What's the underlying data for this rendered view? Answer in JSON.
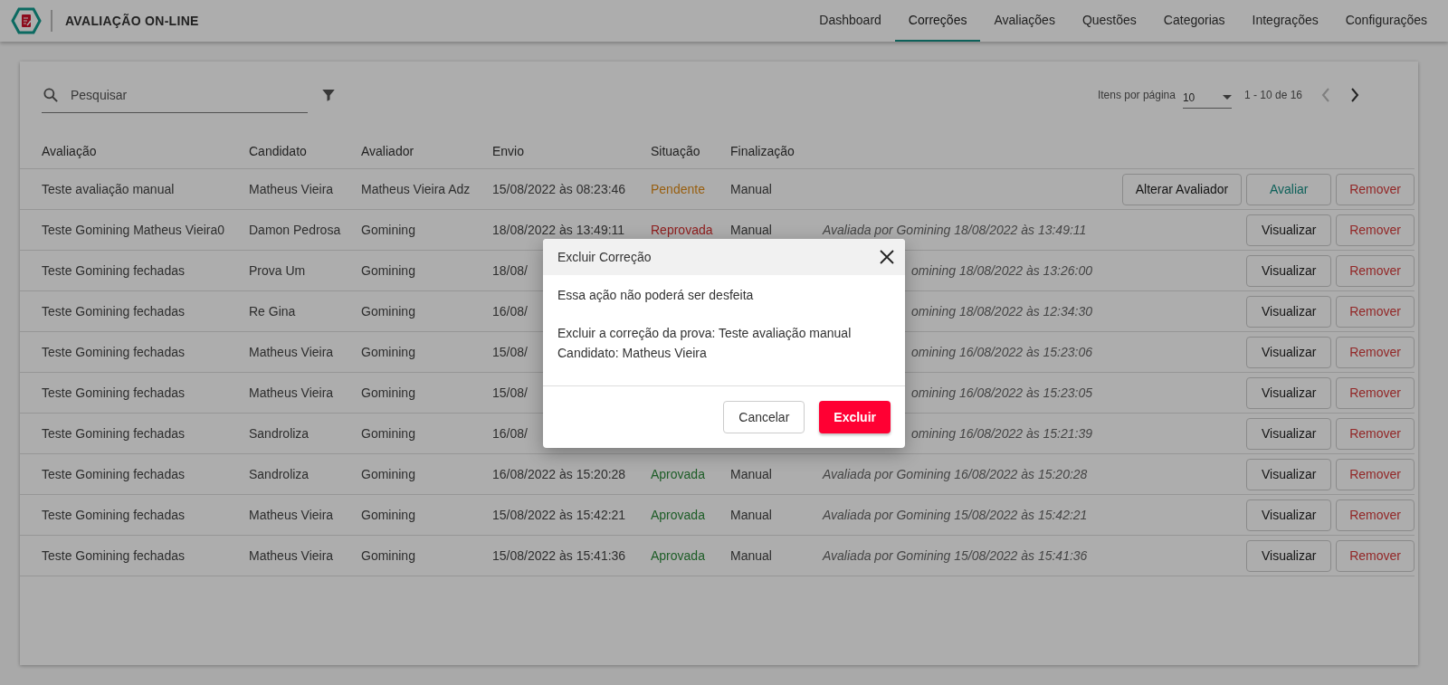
{
  "app": {
    "title": "AVALIAÇÃO ON-LINE"
  },
  "nav": [
    {
      "label": "Dashboard",
      "selected": false
    },
    {
      "label": "Correções",
      "selected": true
    },
    {
      "label": "Avaliações",
      "selected": false
    },
    {
      "label": "Questões",
      "selected": false
    },
    {
      "label": "Categorias",
      "selected": false
    },
    {
      "label": "Integrações",
      "selected": false
    },
    {
      "label": "Configurações",
      "selected": false
    }
  ],
  "search": {
    "placeholder": "Pesquisar"
  },
  "pagination": {
    "label": "Itens por página",
    "page_size": "10",
    "range": "1 - 10 de 16",
    "buttons": [
      {
        "kind": "prev",
        "disabled": true
      },
      {
        "kind": "next",
        "disabled": false
      }
    ]
  },
  "table": {
    "columns": [
      "Avaliação",
      "Candidato",
      "Avaliador",
      "Envio",
      "Situação",
      "Finalização"
    ],
    "rows": [
      {
        "avaliacao": "Teste avaliação manual",
        "candidato": "Matheus Vieira",
        "avaliador": "Matheus Vieira Adz",
        "envio": "15/08/2022 às 08:23:46",
        "situacao": {
          "text": "Pendente",
          "kind": "pending"
        },
        "finalizacao": "Manual",
        "actions": [
          {
            "label": "Alterar Avaliador",
            "kind": "default"
          },
          {
            "label": "Avaliar",
            "kind": "primary"
          },
          {
            "label": "Remover",
            "kind": "danger"
          }
        ]
      },
      {
        "avaliacao": "Teste Gomining Matheus Vieira0",
        "candidato": "Damon Pedrosa",
        "avaliador": "Gomining",
        "envio": "18/08/2022 às 13:49:11",
        "situacao": {
          "text": "Reprovada",
          "kind": "rejected"
        },
        "finalizacao": "Manual",
        "note": {
          "text": "Avaliada por Gomining 18/08/2022 às 13:49:11",
          "covered": false
        },
        "actions": [
          {
            "label": "Visualizar",
            "kind": "default"
          },
          {
            "label": "Remover",
            "kind": "danger"
          }
        ]
      },
      {
        "avaliacao": "Teste Gomining fechadas",
        "candidato": "Prova Um",
        "avaliador": "Gomining",
        "envio": "18/08/",
        "note": {
          "text": "omining 18/08/2022 às 13:26:00",
          "covered": true
        },
        "actions": [
          {
            "label": "Visualizar",
            "kind": "default"
          },
          {
            "label": "Remover",
            "kind": "danger"
          }
        ]
      },
      {
        "avaliacao": "Teste Gomining fechadas",
        "candidato": "Re Gina",
        "avaliador": "Gomining",
        "envio": "16/08/",
        "note": {
          "text": "omining 18/08/2022 às 12:34:30",
          "covered": true
        },
        "actions": [
          {
            "label": "Visualizar",
            "kind": "default"
          },
          {
            "label": "Remover",
            "kind": "danger"
          }
        ]
      },
      {
        "avaliacao": "Teste Gomining fechadas",
        "candidato": "Matheus Vieira",
        "avaliador": "Gomining",
        "envio": "15/08/",
        "note": {
          "text": "omining 16/08/2022 às 15:23:06",
          "covered": true
        },
        "actions": [
          {
            "label": "Visualizar",
            "kind": "default"
          },
          {
            "label": "Remover",
            "kind": "danger"
          }
        ]
      },
      {
        "avaliacao": "Teste Gomining fechadas",
        "candidato": "Matheus Vieira",
        "avaliador": "Gomining",
        "envio": "15/08/",
        "note": {
          "text": "omining 16/08/2022 às 15:23:05",
          "covered": true
        },
        "actions": [
          {
            "label": "Visualizar",
            "kind": "default"
          },
          {
            "label": "Remover",
            "kind": "danger"
          }
        ]
      },
      {
        "avaliacao": "Teste Gomining fechadas",
        "candidato": "Sandroliza",
        "avaliador": "Gomining",
        "envio": "16/08/",
        "note": {
          "text": "omining 16/08/2022 às 15:21:39",
          "covered": true
        },
        "actions": [
          {
            "label": "Visualizar",
            "kind": "default"
          },
          {
            "label": "Remover",
            "kind": "danger"
          }
        ]
      },
      {
        "avaliacao": "Teste Gomining fechadas",
        "candidato": "Sandroliza",
        "avaliador": "Gomining",
        "envio": "16/08/2022 às 15:20:28",
        "situacao": {
          "text": "Aprovada",
          "kind": "approved"
        },
        "finalizacao": "Manual",
        "note": {
          "text": "Avaliada por Gomining 16/08/2022 às 15:20:28",
          "covered": false
        },
        "actions": [
          {
            "label": "Visualizar",
            "kind": "default"
          },
          {
            "label": "Remover",
            "kind": "danger"
          }
        ]
      },
      {
        "avaliacao": "Teste Gomining fechadas",
        "candidato": "Matheus Vieira",
        "avaliador": "Gomining",
        "envio": "15/08/2022 às 15:42:21",
        "situacao": {
          "text": "Aprovada",
          "kind": "approved"
        },
        "finalizacao": "Manual",
        "note": {
          "text": "Avaliada por Gomining 15/08/2022 às 15:42:21",
          "covered": false
        },
        "actions": [
          {
            "label": "Visualizar",
            "kind": "default"
          },
          {
            "label": "Remover",
            "kind": "danger"
          }
        ]
      },
      {
        "avaliacao": "Teste Gomining fechadas",
        "candidato": "Matheus Vieira",
        "avaliador": "Gomining",
        "envio": "15/08/2022 às 15:41:36",
        "situacao": {
          "text": "Aprovada",
          "kind": "approved"
        },
        "finalizacao": "Manual",
        "note": {
          "text": "Avaliada por Gomining 15/08/2022 às 15:41:36",
          "covered": false
        },
        "actions": [
          {
            "label": "Visualizar",
            "kind": "default"
          },
          {
            "label": "Remover",
            "kind": "danger"
          }
        ]
      }
    ]
  },
  "dialog": {
    "title": "Excluir Correção",
    "message": "Essa ação não poderá ser desfeita",
    "details": [
      "Excluir a correção da prova: Teste avaliação manual",
      "Candidato: Matheus Vieira"
    ],
    "buttons": [
      {
        "label": "Cancelar",
        "kind": "secondary"
      },
      {
        "label": "Excluir",
        "kind": "danger"
      }
    ]
  }
}
